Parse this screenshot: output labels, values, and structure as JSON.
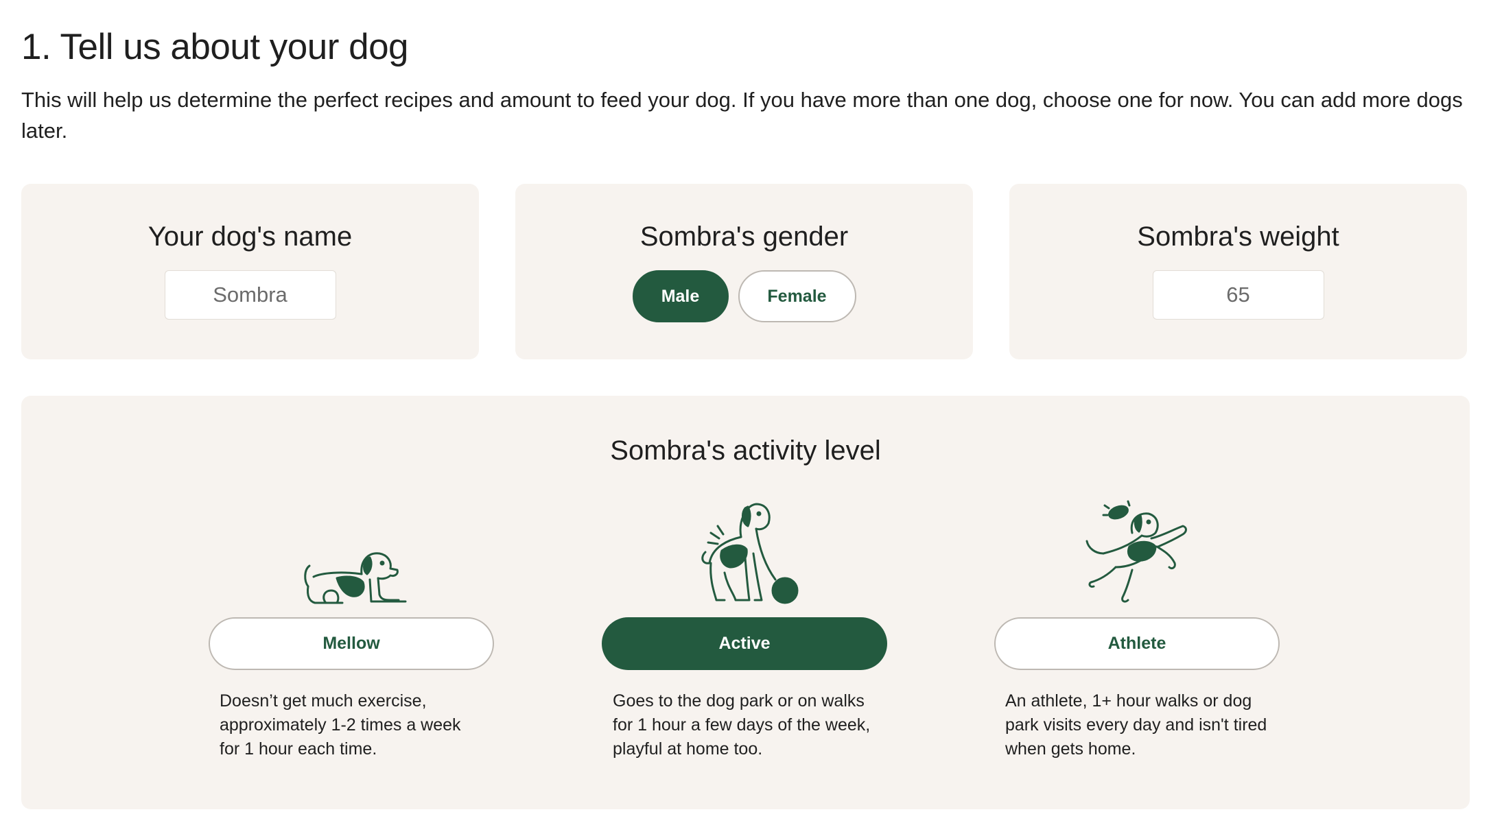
{
  "header": {
    "title": "1. Tell us about your dog",
    "subtitle": "This will help us determine the perfect recipes and amount to feed your dog. If you have more than one dog, choose one for now. You can add more dogs later."
  },
  "name_card": {
    "title": "Your dog's name",
    "value": "Sombra"
  },
  "gender_card": {
    "title": "Sombra's gender",
    "options": [
      {
        "label": "Male",
        "selected": true
      },
      {
        "label": "Female",
        "selected": false
      }
    ]
  },
  "weight_card": {
    "title": "Sombra's weight",
    "value": "65"
  },
  "activity": {
    "title": "Sombra's activity level",
    "options": [
      {
        "label": "Mellow",
        "icon": "lying-dog-icon",
        "selected": false,
        "description": "Doesn’t get much exercise, approximately 1-2 times a week for 1 hour each time."
      },
      {
        "label": "Active",
        "icon": "dog-with-ball-icon",
        "selected": true,
        "description": "Goes to the dog park or on walks for 1 hour a few days of the week, playful at home too."
      },
      {
        "label": "Athlete",
        "icon": "jumping-dog-frisbee-icon",
        "selected": false,
        "description": "An athlete, 1+ hour walks or dog park visits every day and isn't tired when gets home."
      }
    ]
  },
  "colors": {
    "accent": "#235a3f",
    "card_background": "#f7f3ef",
    "text": "#1f1f1f"
  }
}
